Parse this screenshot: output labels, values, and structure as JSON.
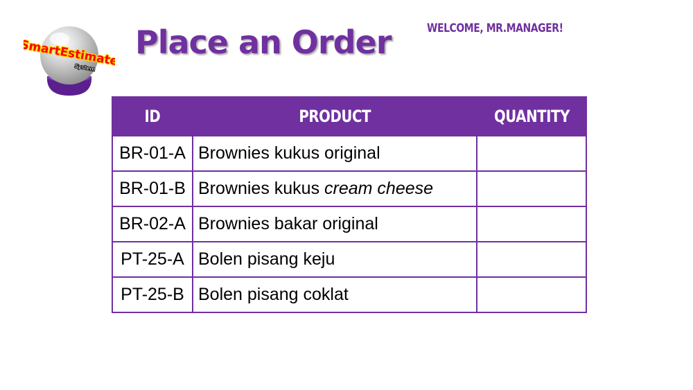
{
  "header": {
    "logo": {
      "text": "SmartEstimate",
      "subtext": "System",
      "colors": {
        "ball": "#c9c9c9",
        "base": "#5b1f8f",
        "text": "#ff0000",
        "text_stroke": "#ffd700"
      }
    },
    "title": "Place an Order",
    "welcome": "WELCOME, MR.MANAGER!"
  },
  "theme": {
    "accent": "#7030a0",
    "header_text": "#ffffff"
  },
  "table": {
    "columns": {
      "id": "ID",
      "product": "PRODUCT",
      "quantity": "QUANTITY"
    },
    "rows": [
      {
        "id": "BR-01-A",
        "product_main": "Brownies kukus original",
        "product_italic": "",
        "quantity": ""
      },
      {
        "id": "BR-01-B",
        "product_main": "Brownies kukus ",
        "product_italic": "cream cheese",
        "quantity": ""
      },
      {
        "id": "BR-02-A",
        "product_main": "Brownies bakar original",
        "product_italic": "",
        "quantity": ""
      },
      {
        "id": "PT-25-A",
        "product_main": "Bolen pisang keju",
        "product_italic": "",
        "quantity": ""
      },
      {
        "id": "PT-25-B",
        "product_main": "Bolen pisang coklat",
        "product_italic": "",
        "quantity": ""
      }
    ]
  }
}
